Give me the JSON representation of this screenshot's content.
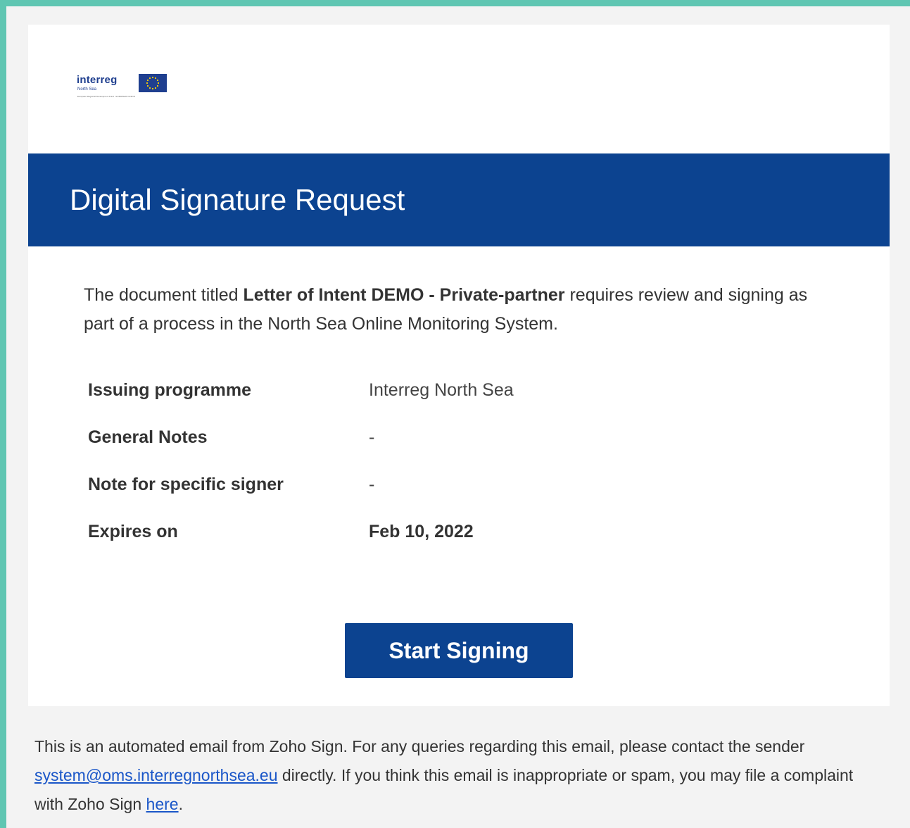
{
  "logo": {
    "word": "interreg",
    "sub": "North Sea",
    "tagline": "European Regional Development Fund · EUROPEAN UNION"
  },
  "banner": {
    "title": "Digital Signature Request"
  },
  "intro": {
    "prefix": "The document titled ",
    "document_title": "Letter of Intent DEMO - Private-partner",
    "suffix": " requires review and signing as part of a process in the North Sea Online Monitoring System."
  },
  "details": [
    {
      "label": "Issuing programme",
      "value": "Interreg North Sea"
    },
    {
      "label": "General Notes",
      "value": "-"
    },
    {
      "label": "Note for specific signer",
      "value": "-"
    },
    {
      "label": "Expires on",
      "value": "Feb 10, 2022"
    }
  ],
  "cta": {
    "label": "Start Signing"
  },
  "footer": {
    "text1": "This is an automated email from Zoho Sign. For any queries regarding this email, please contact the sender ",
    "email": "system@oms.interregnorthsea.eu",
    "text2": " directly. If you think this email is inappropriate or spam, you may file a complaint with Zoho Sign ",
    "link": "here",
    "text3": "."
  },
  "colors": {
    "brand_blue": "#0c4390",
    "frame_teal": "#5fc6b2",
    "link_blue": "#1a56c8"
  }
}
